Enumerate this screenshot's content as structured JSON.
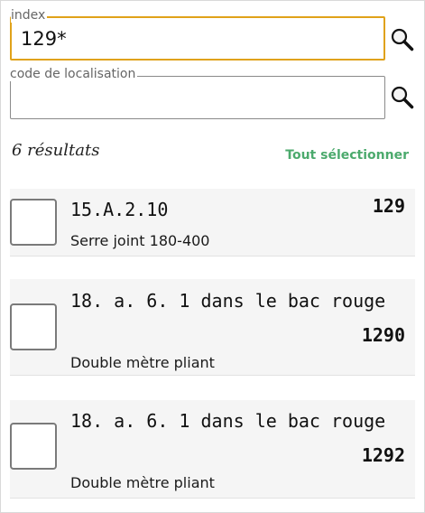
{
  "search": {
    "index_label": "index",
    "index_value": "129*",
    "location_label": "code de localisation",
    "location_value": ""
  },
  "icons": {
    "index_search": "search-icon",
    "location_search": "search-icon"
  },
  "results": {
    "count_label": "6 résultats",
    "select_all_label": "Tout sélectionner",
    "select_all_color": "#4caa6d",
    "items": [
      {
        "code": "15.A.2.10",
        "quantity": "129",
        "description": "Serre joint 180-400",
        "checked": false
      },
      {
        "code": "18. a. 6. 1 dans le bac rouge",
        "quantity": "1290",
        "description": "Double mètre pliant",
        "checked": false
      },
      {
        "code": "18. a. 6. 1 dans le bac rouge",
        "quantity": "1292",
        "description": "Double mètre pliant",
        "checked": false
      }
    ]
  },
  "colors": {
    "active_field_border": "#e0a21a",
    "row_background": "#f5f5f5"
  }
}
